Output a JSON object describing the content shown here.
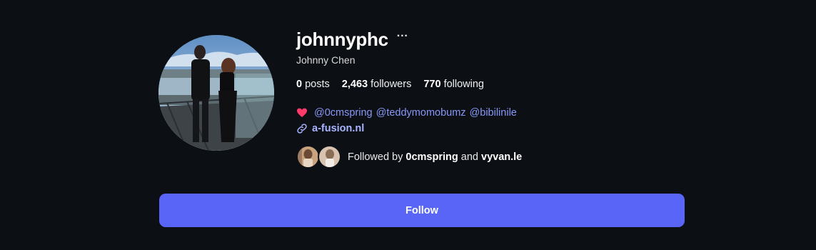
{
  "profile": {
    "username": "johnnyphc",
    "more_label": "···",
    "full_name": "Johnny Chen",
    "stats": {
      "posts_count": "0",
      "posts_label": "posts",
      "followers_count": "2,463",
      "followers_label": "followers",
      "following_count": "770",
      "following_label": "following"
    },
    "bio": {
      "icon": "heart-icon",
      "mentions": [
        "@0cmspring",
        "@teddymomobumz",
        "@bibilinile"
      ]
    },
    "link": {
      "icon": "link-icon",
      "text": "a-fusion.nl"
    },
    "followed_by": {
      "prefix": "Followed by",
      "users": [
        "0cmspring",
        "vyvan.le"
      ],
      "conjunction": "and"
    },
    "follow_button": "Follow"
  },
  "colors": {
    "background": "#0c1014",
    "accent": "#5865f7",
    "mention": "#8897f7",
    "heart": "#ff3b6b"
  }
}
